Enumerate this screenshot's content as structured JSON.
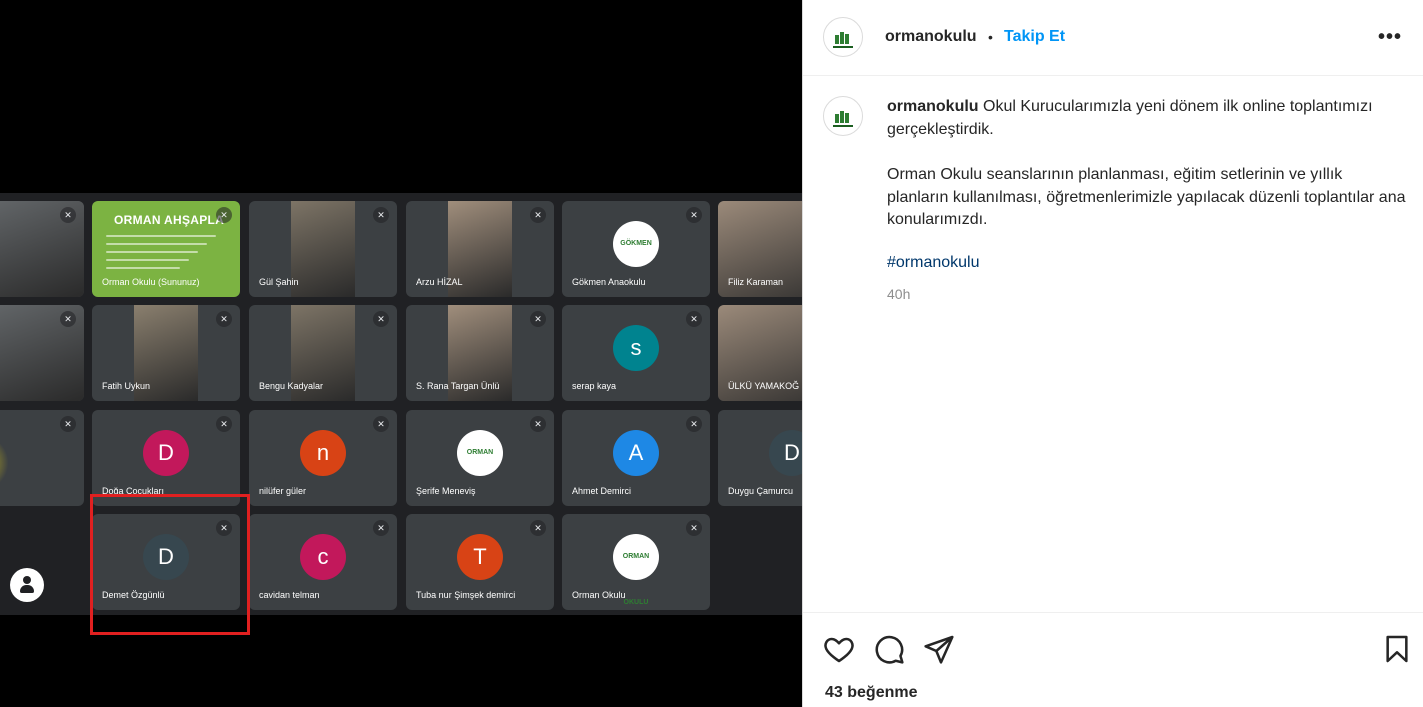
{
  "meet": {
    "tiles": [
      {
        "name": "",
        "kind": "video"
      },
      {
        "name": "Orman Okulu (Sununuz)",
        "kind": "presenter",
        "slide_title": "ORMAN AHŞAPLA"
      },
      {
        "name": "Gül Şahin",
        "kind": "video"
      },
      {
        "name": "Arzu HİZAL",
        "kind": "video"
      },
      {
        "name": "Gökmen Anaokulu",
        "kind": "logo",
        "logo_text": "GÖKMEN"
      },
      {
        "name": "Filiz Karaman",
        "kind": "video"
      },
      {
        "name": "",
        "kind": "video"
      },
      {
        "name": "Fatih Uykun",
        "kind": "video"
      },
      {
        "name": "Bengu Kadyalar",
        "kind": "video"
      },
      {
        "name": "S. Rana Targan Ünlü",
        "kind": "video"
      },
      {
        "name": "serap kaya",
        "kind": "avatar",
        "initial": "s",
        "color": "#00838f"
      },
      {
        "name": "ÜLKÜ YAMAKOĞ",
        "kind": "video"
      },
      {
        "name": "",
        "kind": "image"
      },
      {
        "name": "Doğa Çocukları",
        "kind": "avatar",
        "initial": "D",
        "color": "#c2185b"
      },
      {
        "name": "nilüfer güler",
        "kind": "avatar",
        "initial": "n",
        "color": "#d84315"
      },
      {
        "name": "Şerife Meneviş",
        "kind": "logo",
        "logo_text": "ORMAN"
      },
      {
        "name": "Ahmet Demirci",
        "kind": "avatar",
        "initial": "A",
        "color": "#1e88e5"
      },
      {
        "name": "Duygu Çamurcu",
        "kind": "avatar",
        "initial": "D",
        "color": "#37474f"
      },
      {
        "name": "Demet Özgünlü",
        "kind": "avatar",
        "initial": "D",
        "color": "#37474f"
      },
      {
        "name": "cavidan telman",
        "kind": "avatar",
        "initial": "c",
        "color": "#c2185b"
      },
      {
        "name": "Tuba nur Şimşek demirci",
        "kind": "avatar",
        "initial": "T",
        "color": "#d84315"
      },
      {
        "name": "Orman Okulu",
        "kind": "logo",
        "logo_text": "ORMAN OKULU"
      }
    ],
    "highlight_color": "#e02020"
  },
  "post": {
    "username": "ormanokulu",
    "separator": "•",
    "follow_label": "Takip Et",
    "more_label": "•••",
    "caption_text": " Okul Kurucularımızla yeni dönem ilk online toplantımızı gerçekleştirdik.",
    "caption_paragraph2": "Orman Okulu seanslarının planlanması, eğitim setlerinin ve yıllık planların kullanılması, öğretmenlerimizle yapılacak düzenli toplantılar ana konularımızdı.",
    "hashtag": "#ormanokulu",
    "time": "40h",
    "likes": "43 beğenme"
  },
  "colors": {
    "accent": "#0095f6",
    "text": "#262626",
    "muted": "#8e8e8e",
    "hashtag": "#00376b"
  }
}
